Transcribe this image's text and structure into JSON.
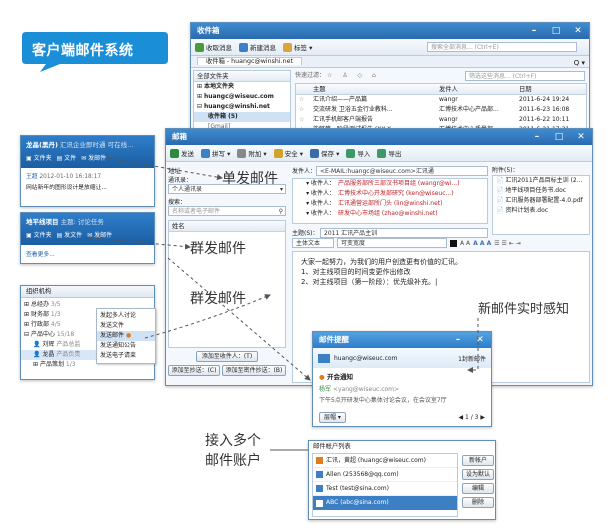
{
  "badge": {
    "title": "客户端邮件系统"
  },
  "main": {
    "title": "收件箱",
    "tb": [
      "收取消息",
      "新建消息",
      "标签"
    ],
    "search": "搜索全部消息... (Ctrl+E)",
    "tab": "收件箱 - huangc@winshi.net",
    "quick": "快速过滤：",
    "quick_search": "筛选这些消息... (Ctrl+F)",
    "folder_hdr": "全部文件夹",
    "folders": [
      "本地文件夹",
      "huangc@wiseuc.com",
      "huangc@winshi.net",
      "收件箱 (5)",
      "[Gmail]"
    ],
    "cols": {
      "subject": "主题",
      "sender": "发件人",
      "date": "日期"
    },
    "mails": [
      {
        "s": "汇讯介绍——产品篇",
        "f": "wangr",
        "d": "2011-6-24 19:24"
      },
      {
        "s": "交流研发 卫浴五金行业教科...",
        "f": "汇博技术中心产品部...",
        "d": "2011-6-23 16:08"
      },
      {
        "s": "汇讯手机邮客户端报告",
        "f": "wangr",
        "d": "2011-6-22 10:11"
      },
      {
        "s": "能够第一阶段测试报告 (XX-X-...",
        "f": "汇博技术中心质量部...",
        "d": "2011-6-21 17:31"
      }
    ]
  },
  "chat": {
    "name": "龙晶(黑丹)",
    "sig": "汇讯企业即时通 可在线...",
    "user": "王超",
    "time": "2012-01-10 16:18:17",
    "msg": "网站新年的图形设计是放缩让...",
    "btns": [
      "文件夹",
      "文件",
      "发邮件"
    ]
  },
  "chat2": {
    "title": "地平线项目",
    "sub": "主题: 讨论任务",
    "btns": [
      "文件夹",
      "发文件",
      "发邮件"
    ],
    "link": "查看更多..."
  },
  "org": {
    "title": "组织机构",
    "tree": [
      {
        "n": "总经办",
        "c": "3/5"
      },
      {
        "n": "财务部",
        "c": "1/3"
      },
      {
        "n": "行政部",
        "c": "4/5"
      },
      {
        "n": "产品中心",
        "c": "15/18"
      },
      {
        "n": "刘辉",
        "c": "产品总监"
      },
      {
        "n": "龙晶",
        "c": "产品负责"
      },
      {
        "n": "产品策划",
        "c": "1/3"
      }
    ],
    "menu": [
      "发起多人讨论",
      "发送文件",
      "发送邮件",
      "发送通知公告",
      "发送电子请束"
    ]
  },
  "compose": {
    "title": "邮箱",
    "tb": [
      "发送",
      "拼写",
      "附加",
      "安全",
      "保存",
      "导入",
      "导出"
    ],
    "addr_label": "地址",
    "book_label": "通讯录：",
    "book_val": "个人通讯录",
    "search_label": "搜索：",
    "search_ph": "名称或者电子邮件",
    "name_col": "姓名",
    "add_btns": [
      "添加至收件人：(T)",
      "添加至抄送：(C)",
      "添加至密件抄送：(B)"
    ],
    "from_label": "发件人：",
    "from_val": "<E-MAIL:huangc@wiseuc.com>汇讯通",
    "recipients": [
      {
        "t": "收件人：",
        "v": "产品服务部所三部汉书项目组 (wangr@wi...)"
      },
      {
        "t": "收件人：",
        "v": "汇博技术中心开发部研究 (ken@wiseuc...)"
      },
      {
        "t": "收件人：",
        "v": "汇讯通营运部所门头 (lin@winshi.net)"
      },
      {
        "t": "收件人：",
        "v": "研发中心市场组 (zhao@winshi.net)"
      }
    ],
    "subj_label": "主题(S)：",
    "subj_val": "2011 汇讯产品主训",
    "attach_label": "附件(5)：",
    "attachments": [
      "汇讯2011产品目标主训 (2...",
      "地平线项目任务书.doc",
      "汇讯服务器部署配置-4.0.pdf",
      "资料计划表.doc"
    ],
    "fmt": [
      "主体文本",
      "可变宽度"
    ],
    "body": [
      "大家一起努力，为我们的用户创造更有价值的汇讯。",
      "1、对主线项目的时间变更作出修改",
      "2、对主线项目（第一阶段）：优先级补充。|"
    ]
  },
  "annot": {
    "single": "单发邮件",
    "group1": "群发邮件",
    "group2": "群发邮件",
    "notify": "新邮件实时感知",
    "multi1": "接入多个",
    "multi2": "邮件账户"
  },
  "popup": {
    "title": "邮件提醒",
    "acct": "huangc@wiseuc.com",
    "count": "1封新邮件",
    "header": "开会通知",
    "from": "杨军",
    "from_addr": "<yang@wiseuc.com>",
    "body": "下午5点开研发中心集体讨论会议，在会议室7厅",
    "menu": "层帽",
    "page": "1 / 3"
  },
  "accounts": {
    "title": "邮件帐户列表",
    "list": [
      {
        "n": "汇讯，黄超 (huangc@wiseuc.com)",
        "sel": false
      },
      {
        "n": "Allen (253568@qq.com)",
        "sel": false
      },
      {
        "n": "Test (test@sina.com)",
        "sel": false
      },
      {
        "n": "ABC (abc@sina.com)",
        "sel": true
      }
    ],
    "btns": [
      "新帐户",
      "设为默认",
      "编辑",
      "删除"
    ]
  }
}
